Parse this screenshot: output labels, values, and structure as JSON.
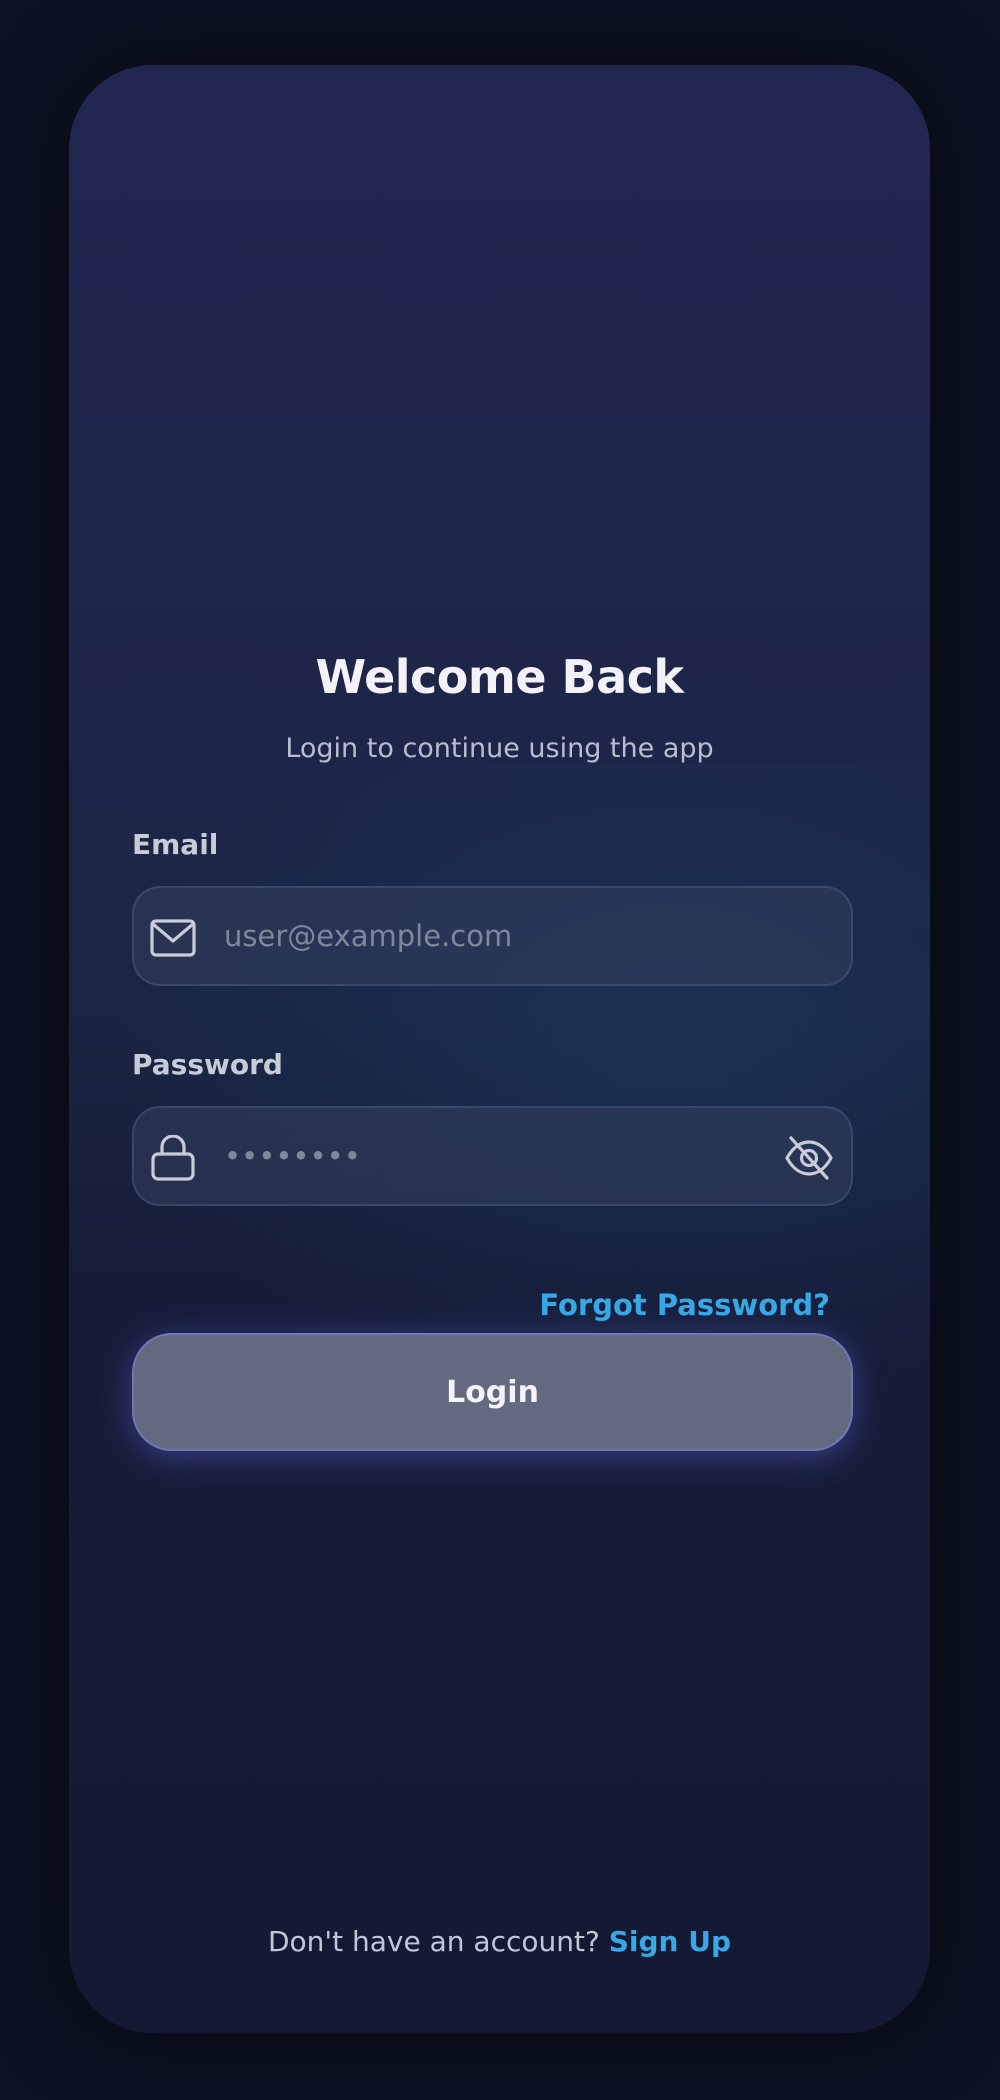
{
  "header": {
    "title": "Welcome Back",
    "subtitle": "Login to continue using the app"
  },
  "email": {
    "label": "Email",
    "placeholder": "user@example.com",
    "value": "",
    "icon": "mail-icon"
  },
  "password": {
    "label": "Password",
    "placeholder": "••••••••",
    "value": "",
    "icon": "lock-icon",
    "toggle_icon": "eye-off-icon"
  },
  "forgot_password": "Forgot Password?",
  "login_button": "Login",
  "signup": {
    "prompt": "Don't have an account?",
    "link": "Sign Up"
  },
  "colors": {
    "accent": "#38a9e6",
    "button": "#636a80",
    "background": "#0c1222"
  }
}
